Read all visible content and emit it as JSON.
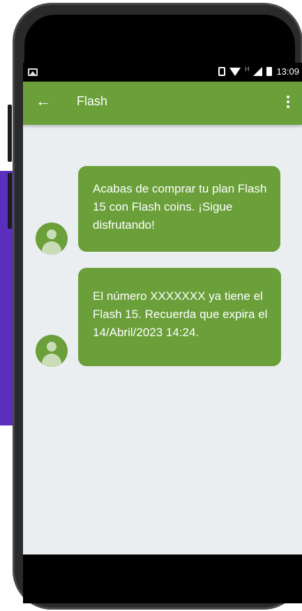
{
  "status_bar": {
    "time": "13:09",
    "network_label": "H",
    "icons": [
      "image-icon",
      "vibrate-icon",
      "wifi-icon",
      "signal-icon",
      "battery-icon"
    ]
  },
  "app_bar": {
    "title": "Flash",
    "back_icon": "arrow-left-icon",
    "menu_icon": "more-vert-icon"
  },
  "messages": [
    {
      "text": "Acabas de comprar tu plan Flash 15 con Flash coins. ¡Sigue disfrutando!"
    },
    {
      "text": "El número XXXXXXX ya tiene el Flash 15. Recuerda que expira el 14/Abril/2023 14:24."
    }
  ],
  "colors": {
    "primary": "#6a9f3a",
    "background": "#ebeef1",
    "accent_left": "#5a2fbf",
    "frame": "#2a2a2a"
  }
}
